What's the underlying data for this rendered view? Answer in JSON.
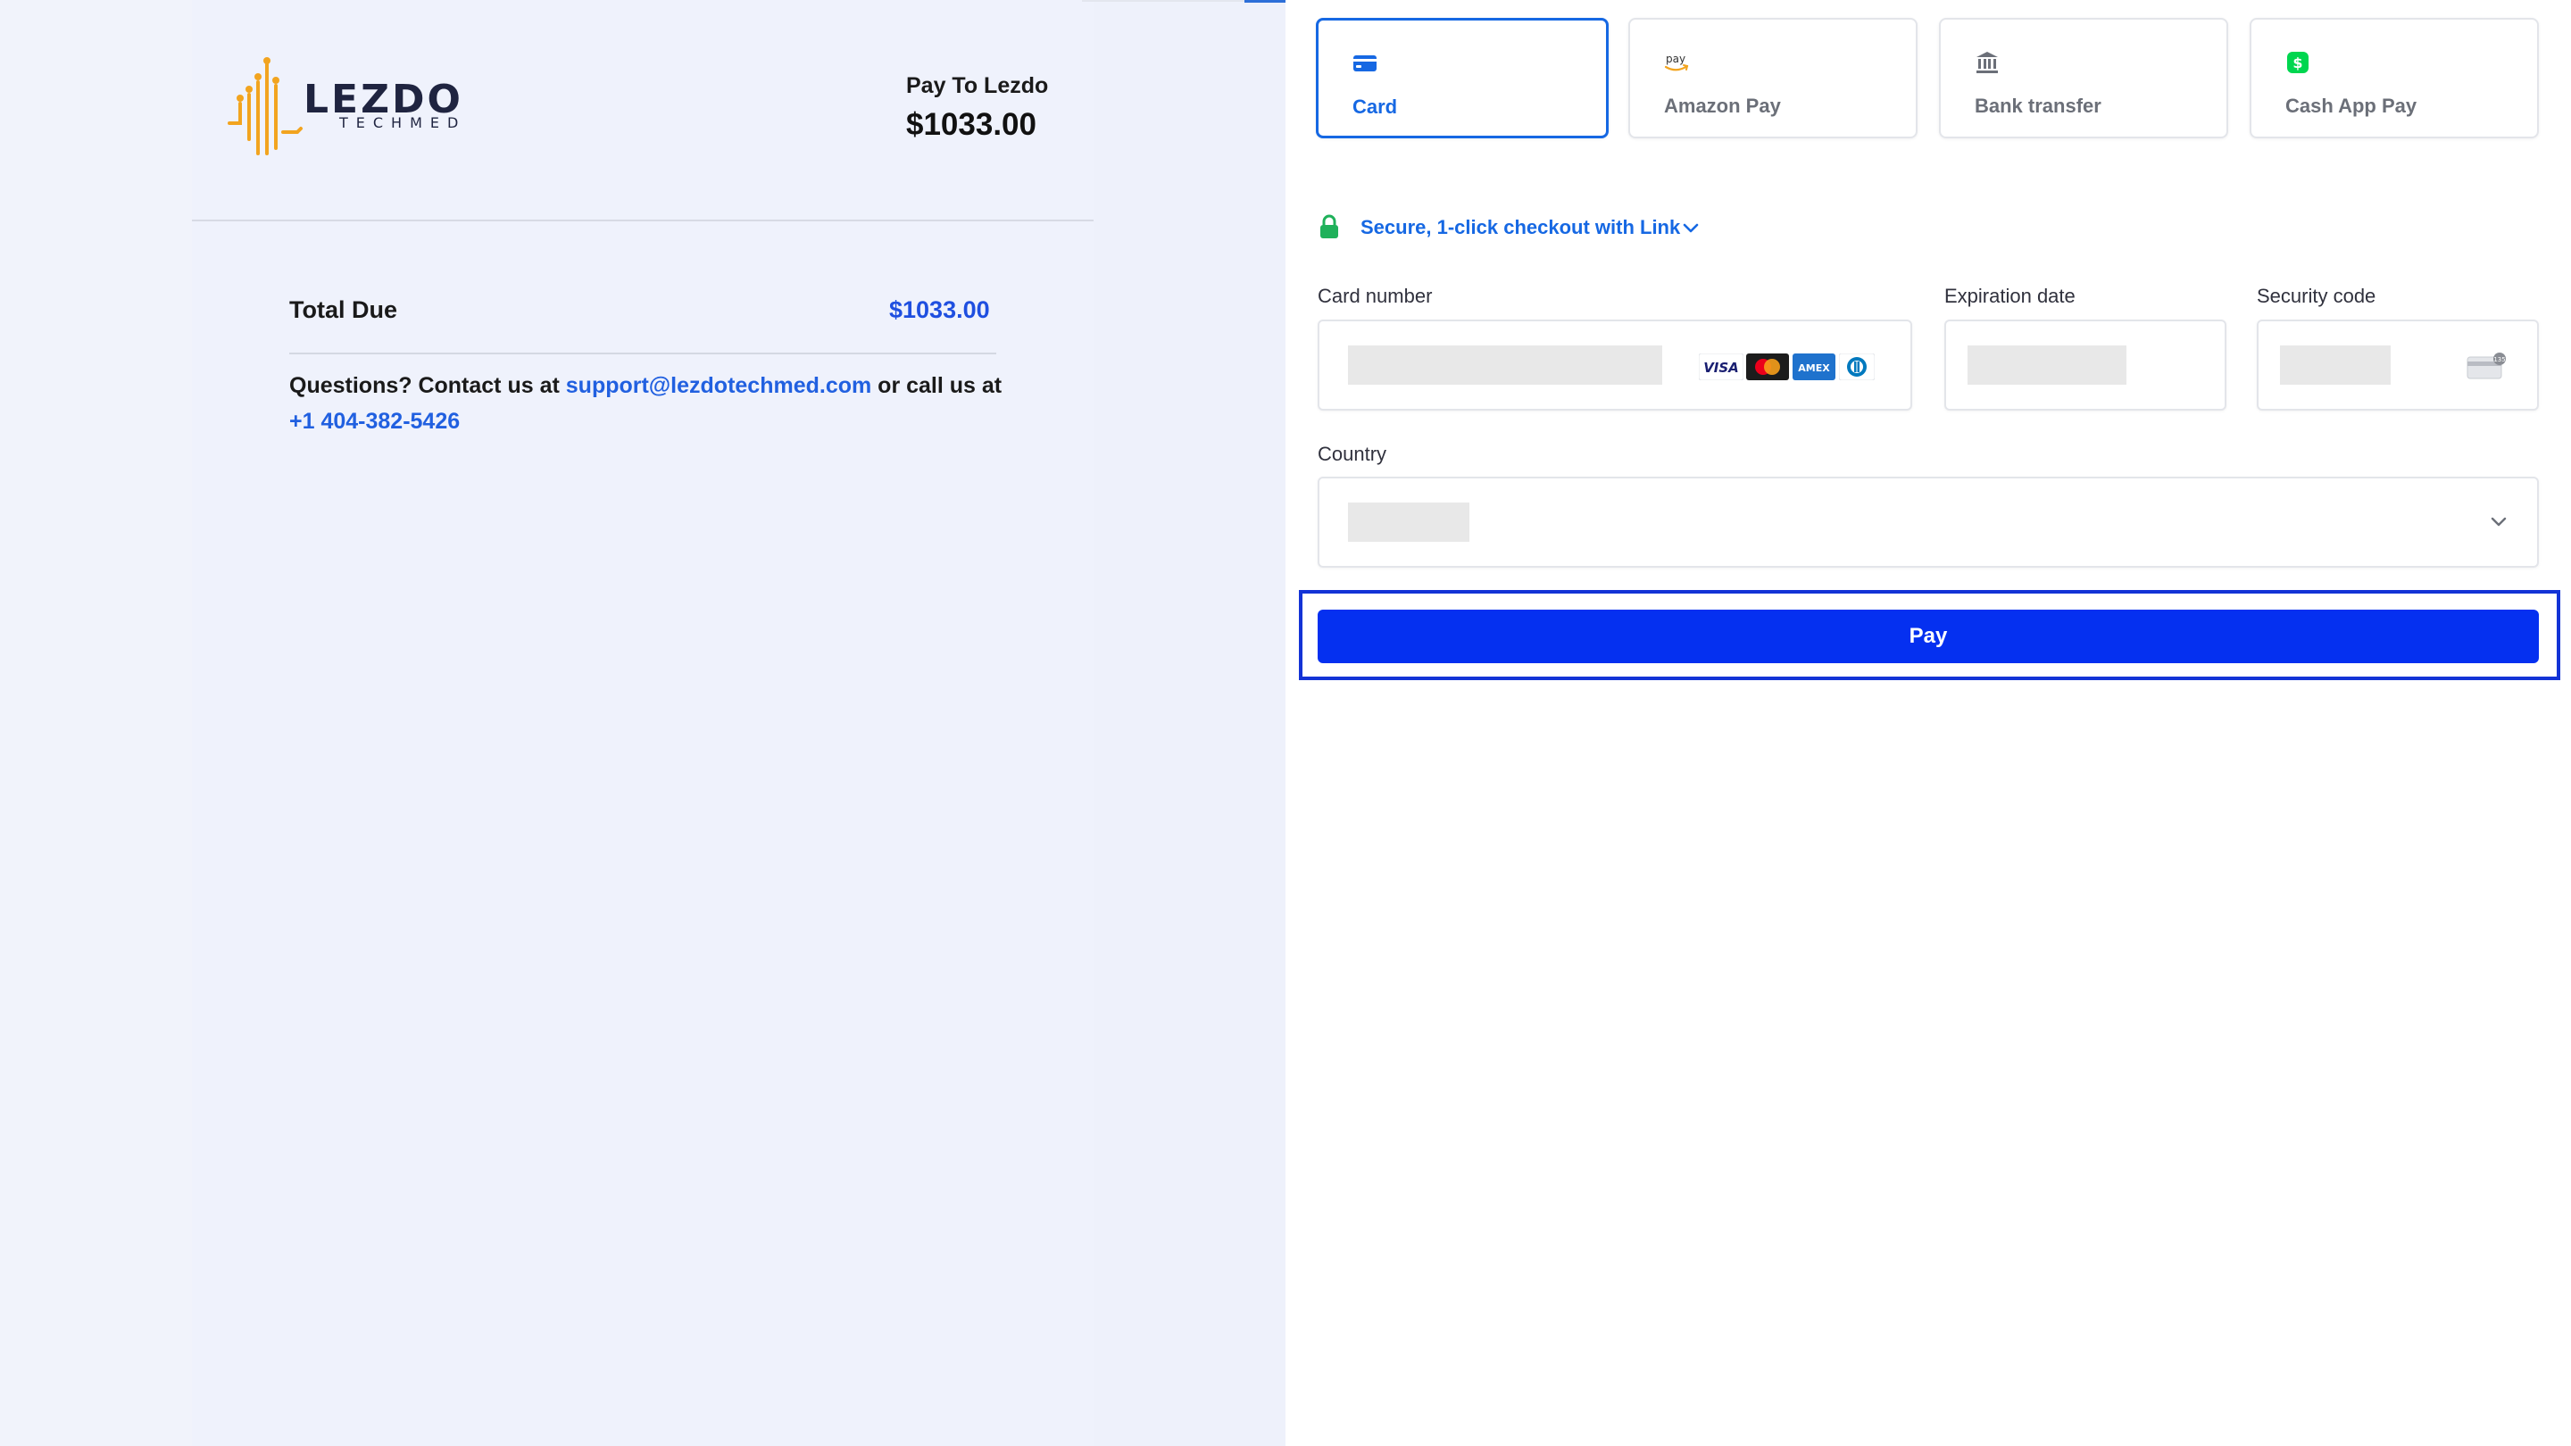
{
  "merchant": {
    "logo_text": "LEZDO",
    "logo_subtext": "TECHMED",
    "pay_to_label": "Pay To Lezdo",
    "pay_to_amount": "$1033.00"
  },
  "summary": {
    "total_label": "Total Due",
    "total_amount": "$1033.00",
    "questions_prefix": "Questions? Contact us at ",
    "support_email": "support@lezdotechmed.com",
    "questions_middle": " or call us at ",
    "support_phone": "+1 404-382-5426"
  },
  "payment_methods": [
    {
      "label": "Card",
      "icon": "card-icon",
      "selected": true
    },
    {
      "label": "Amazon Pay",
      "icon": "amazon-pay-icon",
      "selected": false
    },
    {
      "label": "Bank transfer",
      "icon": "bank-icon",
      "selected": false
    },
    {
      "label": "Cash App Pay",
      "icon": "cash-app-icon",
      "selected": false
    }
  ],
  "link_checkout": {
    "label": "Secure, 1-click checkout with Link",
    "icon": "lock-icon"
  },
  "form": {
    "card_number_label": "Card number",
    "expiration_label": "Expiration date",
    "security_code_label": "Security code",
    "country_label": "Country",
    "card_brands": [
      "visa",
      "mastercard",
      "amex",
      "diners"
    ],
    "pay_label": "Pay"
  },
  "colors": {
    "accent": "#1668e3",
    "pay_button": "#0530f0",
    "link_blue": "#2160e0",
    "logo_orange": "#f2a41f",
    "lock_green": "#1fb15a"
  }
}
